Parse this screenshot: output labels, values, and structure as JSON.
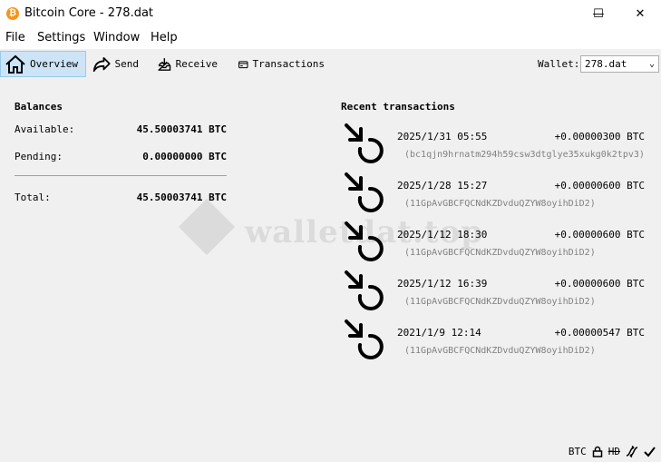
{
  "window": {
    "title": "Bitcoin Core - 278.dat",
    "app_icon_glyph": "₿",
    "controls": {
      "minimize": "—",
      "maximize": "☐",
      "close": "✕"
    }
  },
  "menu": [
    "File",
    "Settings",
    "Window",
    "Help"
  ],
  "toolbar": {
    "items": [
      {
        "label": "Overview",
        "icon": "home-icon",
        "active": true
      },
      {
        "label": "Send",
        "icon": "send-arrow-icon",
        "active": false
      },
      {
        "label": "Receive",
        "icon": "receive-tray-icon",
        "active": false
      },
      {
        "label": "Transactions",
        "icon": "card-icon",
        "active": false
      }
    ],
    "wallet_label": "Wallet:",
    "wallet_value": "278.dat"
  },
  "balances": {
    "heading": "Balances",
    "available_label": "Available:",
    "available_value": "45.50003741 BTC",
    "pending_label": "Pending:",
    "pending_value": "0.00000000 BTC",
    "total_label": "Total:",
    "total_value": "45.50003741 BTC"
  },
  "recent": {
    "heading": "Recent transactions",
    "items": [
      {
        "date": "2025/1/31 05:55",
        "amount": "+0.00000300 BTC",
        "address": "(bc1qjn9hrnatm294h59csw3dtglye35xukg0k2tpv3)"
      },
      {
        "date": "2025/1/28 15:27",
        "amount": "+0.00000600 BTC",
        "address": "(11GpAvGBCFQCNdKZDvduQZYW8oyihDiD2)"
      },
      {
        "date": "2025/1/12 18:30",
        "amount": "+0.00000600 BTC",
        "address": "(11GpAvGBCFQCNdKZDvduQZYW8oyihDiD2)"
      },
      {
        "date": "2025/1/12 16:39",
        "amount": "+0.00000600 BTC",
        "address": "(11GpAvGBCFQCNdKZDvduQZYW8oyihDiD2)"
      },
      {
        "date": "2021/1/9 12:14",
        "amount": "+0.00000547 BTC",
        "address": "(11GpAvGBCFQCNdKZDvduQZYW8oyihDiD2)"
      }
    ]
  },
  "watermark": "walletdat.top",
  "statusbar": {
    "unit": "BTC",
    "hd": "HD"
  },
  "colors": {
    "bitcoin_orange": "#f7931a",
    "active_tab": "#cde4f7"
  }
}
